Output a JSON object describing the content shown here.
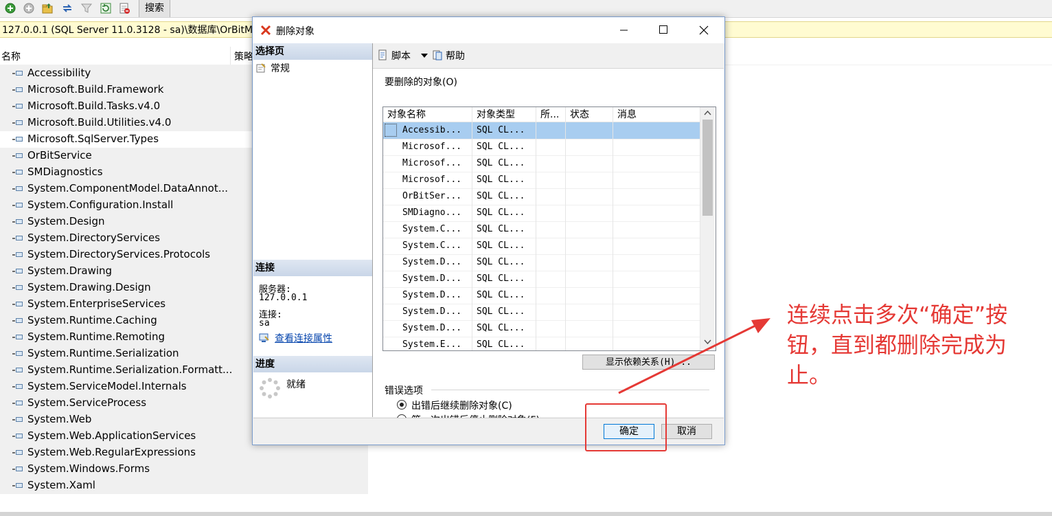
{
  "toolbar": {
    "icons": [
      "refresh-green-icon",
      "add-icon",
      "folder-up-icon",
      "sync-icon",
      "filter-icon",
      "refresh-icon",
      "report-icon"
    ],
    "search_tab": "搜索"
  },
  "pathbar": {
    "text": "127.0.0.1 (SQL Server 11.0.3128 - sa)\\数据库\\OrBitM"
  },
  "columns": {
    "name": "名称",
    "policy": "策略"
  },
  "assemblies": [
    "Accessibility",
    "Microsoft.Build.Framework",
    "Microsoft.Build.Tasks.v4.0",
    "Microsoft.Build.Utilities.v4.0",
    "Microsoft.SqlServer.Types",
    "OrBitService",
    "SMDiagnostics",
    "System.ComponentModel.DataAnnot...",
    "System.Configuration.Install",
    "System.Design",
    "System.DirectoryServices",
    "System.DirectoryServices.Protocols",
    "System.Drawing",
    "System.Drawing.Design",
    "System.EnterpriseServices",
    "System.Runtime.Caching",
    "System.Runtime.Remoting",
    "System.Runtime.Serialization",
    "System.Runtime.Serialization.Formatt...",
    "System.ServiceModel.Internals",
    "System.ServiceProcess",
    "System.Web",
    "System.Web.ApplicationServices",
    "System.Web.RegularExpressions",
    "System.Windows.Forms",
    "System.Xaml"
  ],
  "dialog": {
    "title": "删除对象",
    "select_page_header": "选择页",
    "page_general": "常规",
    "connection_header": "连接",
    "server_label": "服务器:",
    "server_value": "127.0.0.1",
    "connection_label": "连接:",
    "connection_value": "sa",
    "view_connection_props": "查看连接属性",
    "progress_header": "进度",
    "progress_status": "就绪",
    "script_label": "脚本",
    "help_label": "帮助",
    "objects_label": "要删除的对象(O)",
    "grid_headers": [
      "对象名称",
      "对象类型",
      "所...",
      "状态",
      "消息"
    ],
    "grid_rows": [
      [
        "Accessib...",
        "SQL CL..."
      ],
      [
        "Microsof...",
        "SQL CL..."
      ],
      [
        "Microsof...",
        "SQL CL..."
      ],
      [
        "Microsof...",
        "SQL CL..."
      ],
      [
        "OrBitSer...",
        "SQL CL..."
      ],
      [
        "SMDiagno...",
        "SQL CL..."
      ],
      [
        "System.C...",
        "SQL CL..."
      ],
      [
        "System.C...",
        "SQL CL..."
      ],
      [
        "System.D...",
        "SQL CL..."
      ],
      [
        "System.D...",
        "SQL CL..."
      ],
      [
        "System.D...",
        "SQL CL..."
      ],
      [
        "System.D...",
        "SQL CL..."
      ],
      [
        "System.D...",
        "SQL CL..."
      ],
      [
        "System.E...",
        "SQL CL..."
      ]
    ],
    "show_dependencies": "显示依赖关系(H)...",
    "error_options_label": "错误选项",
    "option_continue": "出错后继续删除对象(C)",
    "option_stop": "第一次出错后停止删除对象(F)",
    "ok_label": "确定",
    "cancel_label": "取消"
  },
  "annotation": {
    "note": "连续点击多次“确定”按钮，直到都删除完成为止。",
    "color": "#e53935"
  }
}
